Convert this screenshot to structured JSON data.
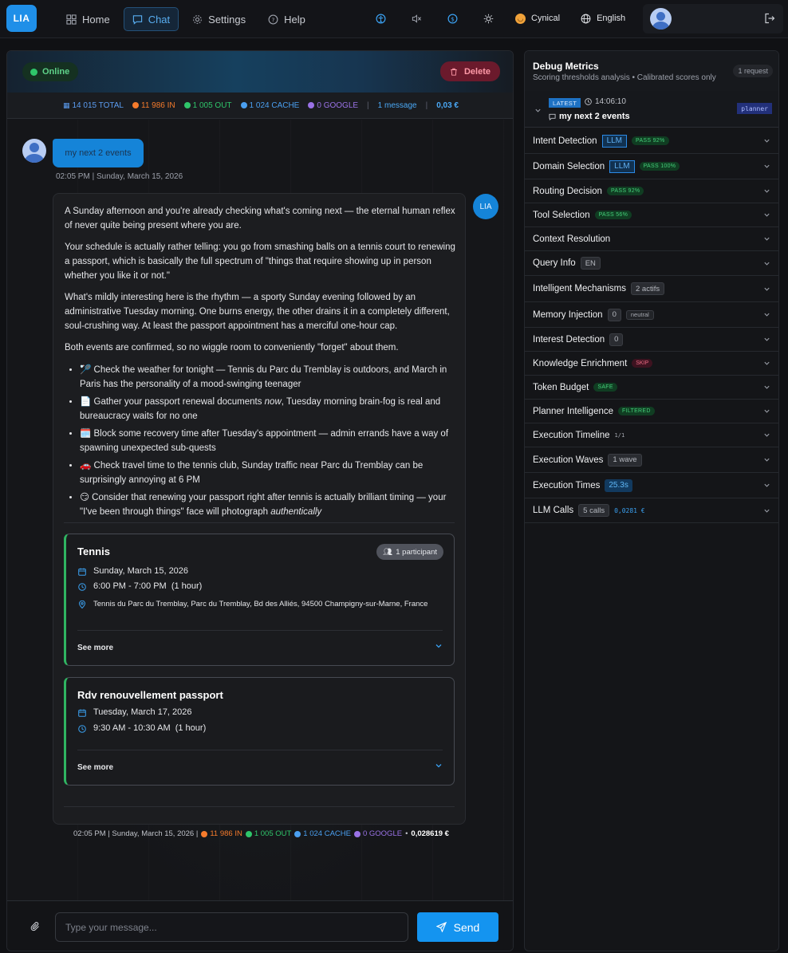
{
  "topbar": {
    "logo": "LIA",
    "nav": [
      {
        "label": "Home",
        "icon": "home-icon"
      },
      {
        "label": "Chat",
        "icon": "chat-icon",
        "active": true
      },
      {
        "label": "Settings",
        "icon": "gear-icon"
      },
      {
        "label": "Help",
        "icon": "help-icon"
      }
    ],
    "persona": "Cynical",
    "language": "English"
  },
  "chat": {
    "status": "Online",
    "delete_label": "Delete",
    "tokens": {
      "total": "14 015 TOTAL",
      "in": "11 986 IN",
      "out": "1 005 OUT",
      "cache": "1 024 CACHE",
      "google": "0 GOOGLE",
      "messages": "1 message",
      "cost": "0,03 €"
    },
    "user_message": "my next 2 events",
    "user_time": "02:05 PM | Sunday, March 15, 2026",
    "assistant_avatar": "LIA",
    "assistant": {
      "p1": "A Sunday afternoon and you're already checking what's coming next — the eternal human reflex of never quite being present where you are.",
      "p2": "Your schedule is actually rather telling: you go from smashing balls on a tennis court to renewing a passport, which is basically the full spectrum of \"things that require showing up in person whether you like it or not.\"",
      "p3": "What's mildly interesting here is the rhythm — a sporty Sunday evening followed by an administrative Tuesday morning. One burns energy, the other drains it in a completely different, soul-crushing way. At least the passport appointment has a merciful one-hour cap.",
      "p4": "Both events are confirmed, so no wiggle room to conveniently \"forget\" about them.",
      "bullets": [
        {
          "pre": "🏸 Check the weather for tonight — Tennis du Parc du Tremblay is outdoors, and March in Paris has the personality of a mood-swinging teenager",
          "em": "",
          "post": ""
        },
        {
          "pre": "📄 Gather your passport renewal documents ",
          "em": "now",
          "post": ", Tuesday morning brain-fog is real and bureaucracy waits for no one"
        },
        {
          "pre": "🗓️ Block some recovery time after Tuesday's appointment — admin errands have a way of spawning unexpected sub-quests",
          "em": "",
          "post": ""
        },
        {
          "pre": "🚗 Check travel time to the tennis club, Sunday traffic near Parc du Tremblay can be surprisingly annoying at 6 PM",
          "em": "",
          "post": ""
        },
        {
          "pre": "😏 Consider that renewing your passport right after tennis is actually brilliant timing — your \"I've been through things\" face will photograph ",
          "em": "authentically",
          "post": ""
        }
      ]
    },
    "events": [
      {
        "title": "Tennis",
        "participants": "1 participant",
        "date": "Sunday, March 15, 2026",
        "time": "6:00 PM - 7:00 PM  (1 hour)",
        "location": "Tennis du Parc du Tremblay, Parc du Tremblay, Bd des Alliés, 94500 Champigny-sur-Marne, France",
        "see_more": "See more"
      },
      {
        "title": "Rdv renouvellement passport",
        "date": "Tuesday, March 17, 2026",
        "time": "9:30 AM - 10:30 AM  (1 hour)",
        "see_more": "See more"
      }
    ],
    "footer": {
      "time": "02:05 PM | Sunday, March 15, 2026 |",
      "in": "11 986 IN",
      "out": "1 005 OUT",
      "cache": "1 024 CACHE",
      "google": "0 GOOGLE",
      "bullet": "•",
      "cost": "0,028619 €"
    },
    "input_placeholder": "Type your message...",
    "send_label": "Send"
  },
  "debug": {
    "title": "Debug Metrics",
    "subtitle": "Scoring thresholds analysis • Calibrated scores only",
    "requests": "1 request",
    "latest": {
      "badge": "LATEST",
      "time": "14:06:10",
      "query": "my next 2 events",
      "tag": "planner"
    },
    "rows": [
      {
        "label": "Intent Detection",
        "llm": "LLM",
        "pass": "PASS 92%"
      },
      {
        "label": "Domain Selection",
        "llm": "LLM",
        "pass": "PASS 100%"
      },
      {
        "label": "Routing Decision",
        "pass": "PASS 92%"
      },
      {
        "label": "Tool Selection",
        "pass": "PASS 56%"
      },
      {
        "label": "Context Resolution"
      },
      {
        "label": "Query Info",
        "gray": "EN"
      },
      {
        "label": "Intelligent Mechanisms",
        "gray": "2 actifs"
      },
      {
        "label": "Memory Injection",
        "gray": "0",
        "small": "neutral"
      },
      {
        "label": "Interest Detection",
        "gray": "0"
      },
      {
        "label": "Knowledge Enrichment",
        "skip": "SKIP"
      },
      {
        "label": "Token Budget",
        "pass": "SAFE"
      },
      {
        "label": "Planner Intelligence",
        "pass": "FILTERED"
      },
      {
        "label": "Execution Timeline",
        "mono": "1/1"
      },
      {
        "label": "Execution Waves",
        "gray": "1 wave"
      },
      {
        "label": "Execution Times",
        "blue": "25.3s"
      },
      {
        "label": "LLM Calls",
        "gray": "5 calls",
        "cost": "0,0281 €"
      }
    ]
  },
  "colors": {
    "accent": "#1494f0",
    "online": "#2fc56a",
    "event_border": "#2fb562",
    "delete": "#6b1a2c",
    "in": "#f57b2c",
    "out": "#2fc56a",
    "cache": "#4a9ff0",
    "google": "#9a72e6"
  }
}
